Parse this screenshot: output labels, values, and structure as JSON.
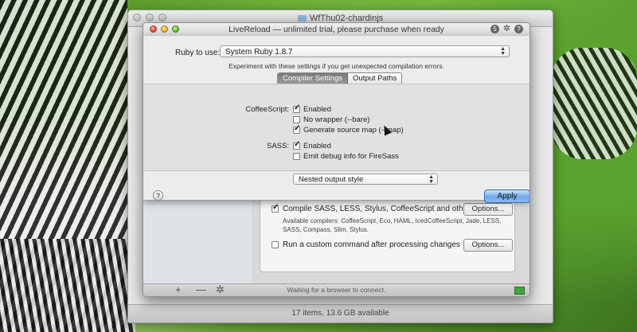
{
  "finder": {
    "title": "WfThu02-chardinjs",
    "status": "17 items, 13.6 GB available"
  },
  "livereload": {
    "title": "LiveReload — unlimited trial, please purchase when ready",
    "title_tool_badge": "5",
    "title_tool_help": "?",
    "sheet": {
      "ruby_label": "Ruby to use:",
      "ruby_value": "System Ruby 1.8.7",
      "hint": "Experiment with these settings if you get unexpected compilation errors.",
      "tabs": [
        {
          "label": "Compiler Settings",
          "active": true
        },
        {
          "label": "Output Paths",
          "active": false
        }
      ],
      "coffeescript": {
        "label": "CoffeeScript:",
        "enabled": {
          "label": "Enabled",
          "checked": true
        },
        "no_wrapper": {
          "label": "No wrapper (--bare)",
          "checked": false
        },
        "source_map": {
          "label": "Generate source map (--map)",
          "checked": true
        }
      },
      "sass": {
        "label": "SASS:",
        "enabled": {
          "label": "Enabled",
          "checked": true
        },
        "debug_info": {
          "label": "Emit debug info for FireSass",
          "checked": false
        },
        "output_style": "Nested output style"
      },
      "help_label": "?",
      "apply_label": "Apply"
    },
    "main": {
      "compile_label": "Compile SASS, LESS, Stylus, CoffeeScript and others",
      "compile_checked": true,
      "compilers_note": "Available compilers: CoffeeScript, Eco, HAML, IcedCoffeeScript, Jade, LESS, SASS, Compass, Slim, Stylus.",
      "options_label_1": "Options...",
      "custom_command_label": "Run a custom command after processing changes",
      "custom_command_checked": false,
      "options_label_2": "Options...",
      "status": "Waiting for a browser to connect.",
      "add_label": "+",
      "remove_label": "—",
      "gear_label": "✲"
    }
  },
  "colors": {
    "accent_blue": "#6fa7ea",
    "status_green": "#3fa63a"
  }
}
